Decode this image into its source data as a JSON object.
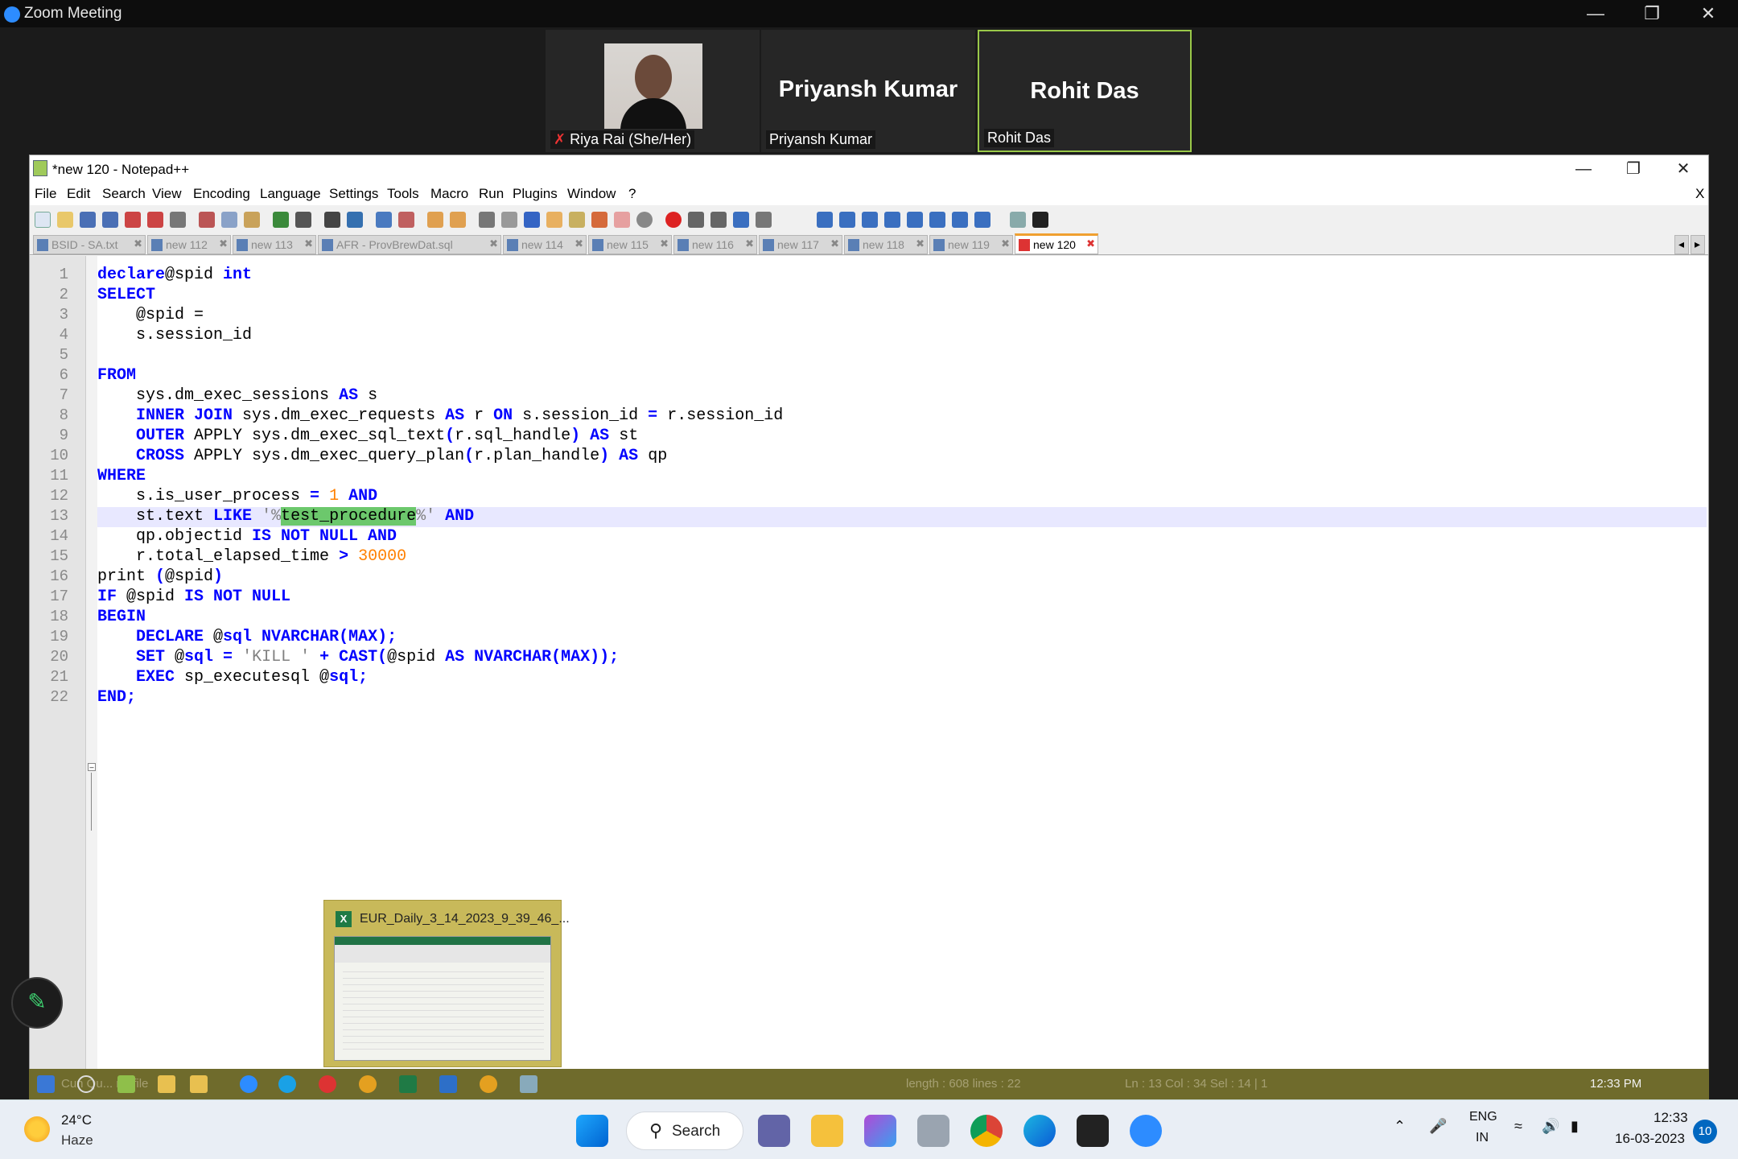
{
  "zoom": {
    "title": "Zoom Meeting"
  },
  "participants": [
    {
      "display": "",
      "label": "Riya Rai (She/Her)"
    },
    {
      "display": "Priyansh Kumar",
      "label": "Priyansh Kumar"
    },
    {
      "display": "Rohit Das",
      "label": "Rohit Das"
    }
  ],
  "npp": {
    "title": "*new 120 - Notepad++",
    "menu": [
      "File",
      "Edit",
      "Search",
      "View",
      "Encoding",
      "Language",
      "Settings",
      "Tools",
      "Macro",
      "Run",
      "Plugins",
      "Window",
      "?"
    ],
    "close_doc": "X",
    "tabs": [
      "BSID - SA.txt",
      "new 112",
      "new 113",
      "AFR - ProvBrewDat.sql",
      "new 114",
      "new 115",
      "new 116",
      "new 117",
      "new 118",
      "new 119",
      "new 120"
    ],
    "line_numbers": [
      "1",
      "2",
      "3",
      "4",
      "5",
      "6",
      "7",
      "8",
      "9",
      "10",
      "11",
      "12",
      "13",
      "14",
      "15",
      "16",
      "17",
      "18",
      "19",
      "20",
      "21",
      "22"
    ]
  },
  "code": [
    [
      [
        "kw",
        "declare"
      ],
      [
        "",
        "@spid "
      ],
      [
        "kw",
        "int"
      ]
    ],
    [
      [
        "kw",
        "SELECT"
      ]
    ],
    [
      [
        "",
        "    @spid ="
      ]
    ],
    [
      [
        "",
        "    s.session_id"
      ]
    ],
    [],
    [
      [
        "kw",
        "FROM"
      ]
    ],
    [
      [
        "",
        "    sys.dm_exec_sessions "
      ],
      [
        "kw",
        "AS"
      ],
      [
        "",
        " s"
      ]
    ],
    [
      [
        "",
        "    "
      ],
      [
        "kw",
        "INNER JOIN"
      ],
      [
        "",
        " sys.dm_exec_requests "
      ],
      [
        "kw",
        "AS"
      ],
      [
        "",
        " r "
      ],
      [
        "kw",
        "ON"
      ],
      [
        "",
        " s.session_id "
      ],
      [
        "kw",
        "="
      ],
      [
        "",
        " r.session_id"
      ]
    ],
    [
      [
        "",
        "    "
      ],
      [
        "kw",
        "OUTER"
      ],
      [
        "",
        " APPLY sys.dm_exec_sql_text"
      ],
      [
        "kw",
        "("
      ],
      [
        "",
        "r.sql_handle"
      ],
      [
        "kw",
        ")"
      ],
      [
        "",
        " "
      ],
      [
        "kw",
        "AS"
      ],
      [
        "",
        " st"
      ]
    ],
    [
      [
        "",
        "    "
      ],
      [
        "kw",
        "CROSS"
      ],
      [
        "",
        " APPLY sys.dm_exec_query_plan"
      ],
      [
        "kw",
        "("
      ],
      [
        "",
        "r.plan_handle"
      ],
      [
        "kw",
        ")"
      ],
      [
        "",
        " "
      ],
      [
        "kw",
        "AS"
      ],
      [
        "",
        " qp"
      ]
    ],
    [
      [
        "kw",
        "WHERE"
      ]
    ],
    [
      [
        "",
        "    s.is_user_process "
      ],
      [
        "kw",
        "="
      ],
      [
        "",
        " "
      ],
      [
        "num",
        "1"
      ],
      [
        "",
        " "
      ],
      [
        "kw",
        "AND"
      ]
    ],
    [
      [
        "",
        "    st.text "
      ],
      [
        "kw",
        "LIKE"
      ],
      [
        "",
        " "
      ],
      [
        "str",
        "'%"
      ],
      [
        "hl",
        "test_procedure"
      ],
      [
        "str",
        "%'"
      ],
      [
        "",
        " "
      ],
      [
        "kw",
        "AND"
      ]
    ],
    [
      [
        "",
        "    qp.objectid "
      ],
      [
        "kw",
        "IS NOT NULL AND"
      ]
    ],
    [
      [
        "",
        "    r.total_elapsed_time "
      ],
      [
        "kw",
        ">"
      ],
      [
        "",
        " "
      ],
      [
        "num",
        "30000"
      ]
    ],
    [
      [
        "",
        "print "
      ],
      [
        "kw",
        "("
      ],
      [
        "",
        "@spid"
      ],
      [
        "kw",
        ")"
      ]
    ],
    [
      [
        "kw",
        "IF"
      ],
      [
        "",
        " @spid "
      ],
      [
        "kw",
        "IS NOT NULL"
      ]
    ],
    [
      [
        "kw",
        "BEGIN"
      ]
    ],
    [
      [
        "",
        "    "
      ],
      [
        "kw",
        "DECLARE"
      ],
      [
        "",
        " @"
      ],
      [
        "kw",
        "sql NVARCHAR(MAX);"
      ]
    ],
    [
      [
        "",
        "    "
      ],
      [
        "kw",
        "SET"
      ],
      [
        "",
        " @"
      ],
      [
        "kw",
        "sql ="
      ],
      [
        "",
        " "
      ],
      [
        "str",
        "'KILL '"
      ],
      [
        "",
        " "
      ],
      [
        "kw",
        "+ CAST("
      ],
      [
        "",
        "@spid "
      ],
      [
        "kw",
        "AS NVARCHAR(MAX));"
      ]
    ],
    [
      [
        "",
        "    "
      ],
      [
        "kw",
        "EXEC"
      ],
      [
        "",
        " sp_executesql @"
      ],
      [
        "kw",
        "sql;"
      ]
    ],
    [
      [
        "kw",
        "END;"
      ]
    ]
  ],
  "preview": {
    "title": "EUR_Daily_3_14_2023_9_39_46_..."
  },
  "old_taskbar": {
    "faded_left": "Cun  Qu...  ng file",
    "status": "length : 608    lines : 22",
    "pos": "Ln : 13    Col : 34    Sel : 14 | 1",
    "time": "12:33 PM"
  },
  "weather": {
    "temp": "24°C",
    "cond": "Haze"
  },
  "search": {
    "label": "Search"
  },
  "tray": {
    "lang": "ENG",
    "region": "IN",
    "time": "12:33",
    "date": "16-03-2023",
    "badge": "10"
  }
}
